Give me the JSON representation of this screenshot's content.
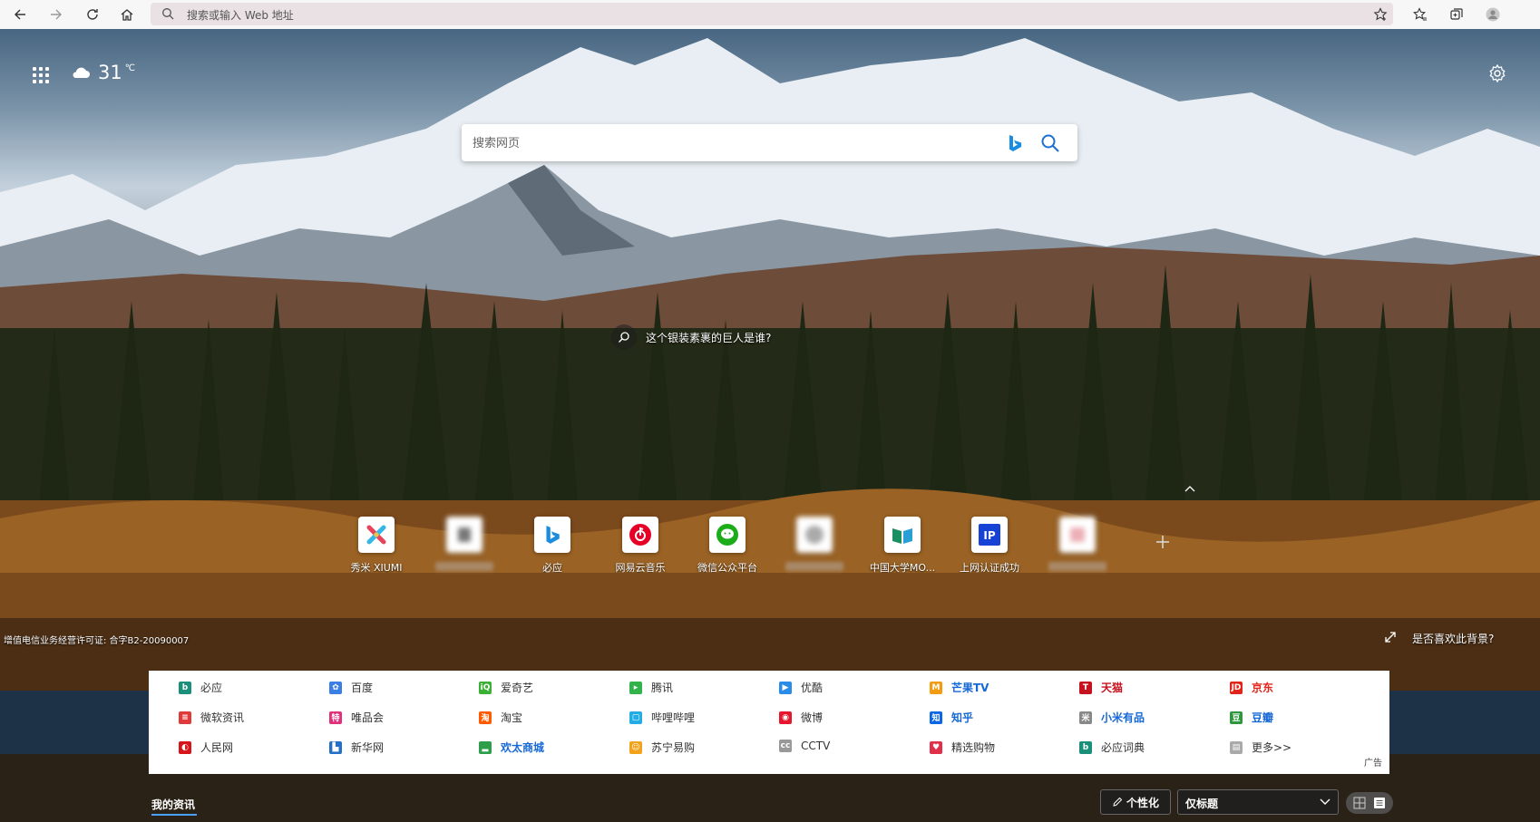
{
  "toolbar": {
    "address_placeholder": "搜索或输入 Web 地址",
    "icons": [
      "back-icon",
      "forward-icon",
      "refresh-icon",
      "home-icon",
      "search-icon",
      "add-favorite-icon",
      "favorites-icon",
      "collections-icon",
      "profile-icon"
    ]
  },
  "header": {
    "temperature": "31",
    "unit": "℃",
    "weather_icon": "cloud-icon"
  },
  "search": {
    "placeholder": "搜索网页"
  },
  "hint": {
    "text": "这个银装素裹的巨人是谁?"
  },
  "quick_links": [
    {
      "label": "秀米 XIUMI",
      "color": "#ffffff",
      "fg": "#e03c3c",
      "glyph": "✕"
    },
    {
      "label": "",
      "color": "#ffffff",
      "fg": "#666666",
      "glyph": "■"
    },
    {
      "label": "必应",
      "color": "#ffffff",
      "fg": "#1a73e8",
      "glyph": "b"
    },
    {
      "label": "网易云音乐",
      "color": "#ffffff",
      "fg": "#e60026",
      "glyph": "◎"
    },
    {
      "label": "微信公众平台",
      "color": "#ffffff",
      "fg": "#1aad19",
      "glyph": "●"
    },
    {
      "label": "",
      "color": "#ffffff",
      "fg": "#999999",
      "glyph": "■"
    },
    {
      "label": "中国大学MO...",
      "color": "#ffffff",
      "fg": "#1a8f62",
      "glyph": "▮"
    },
    {
      "label": "上网认证成功",
      "color": "#ffffff",
      "fg": "#1742d6",
      "glyph": "IP"
    },
    {
      "label": "",
      "color": "#ffffff",
      "fg": "#e79aa3",
      "glyph": "■"
    }
  ],
  "footer": {
    "license": "增值电信业务经营许可证: 合字B2-20090007",
    "like_bg": "是否喜欢此背景?"
  },
  "links": [
    [
      {
        "label": "必应",
        "icon": "b",
        "color": "#1a8f7a",
        "bold": false,
        "text_color": "#333333"
      },
      {
        "label": "百度",
        "icon": "✿",
        "color": "#3a7ee6",
        "bold": false,
        "text_color": "#333333"
      },
      {
        "label": "爱奇艺",
        "icon": "iQ",
        "color": "#3cb034",
        "bold": false,
        "text_color": "#333333"
      },
      {
        "label": "腾讯",
        "icon": "▸",
        "color": "#31b24b",
        "bold": false,
        "text_color": "#333333"
      },
      {
        "label": "优酷",
        "icon": "▶",
        "color": "#2b8be8",
        "bold": false,
        "text_color": "#333333"
      },
      {
        "label": "芒果TV",
        "icon": "M",
        "color": "#f39c12",
        "bold": true,
        "text_color": "#1668d6"
      },
      {
        "label": "天猫",
        "icon": "T",
        "color": "#c6121e",
        "bold": true,
        "text_color": "#c6121e"
      },
      {
        "label": "京东",
        "icon": "JD",
        "color": "#e1251b",
        "bold": true,
        "text_color": "#e1251b"
      }
    ],
    [
      {
        "label": "微软资讯",
        "icon": "≡",
        "color": "#e03a3a",
        "bold": false,
        "text_color": "#333333"
      },
      {
        "label": "唯品会",
        "icon": "特",
        "color": "#e0307c",
        "bold": false,
        "text_color": "#333333"
      },
      {
        "label": "淘宝",
        "icon": "淘",
        "color": "#ff5a00",
        "bold": false,
        "text_color": "#333333"
      },
      {
        "label": "哔哩哔哩",
        "icon": "▢",
        "color": "#23ade5",
        "bold": false,
        "text_color": "#333333"
      },
      {
        "label": "微博",
        "icon": "◉",
        "color": "#e6162d",
        "bold": false,
        "text_color": "#333333"
      },
      {
        "label": "知乎",
        "icon": "知",
        "color": "#0a66e4",
        "bold": true,
        "text_color": "#1668d6"
      },
      {
        "label": "小米有品",
        "icon": "米",
        "color": "#888888",
        "bold": true,
        "text_color": "#1668d6"
      },
      {
        "label": "豆瓣",
        "icon": "豆",
        "color": "#2e963d",
        "bold": true,
        "text_color": "#1668d6"
      }
    ],
    [
      {
        "label": "人民网",
        "icon": "◐",
        "color": "#d7141a",
        "bold": false,
        "text_color": "#333333"
      },
      {
        "label": "新华网",
        "icon": "▙",
        "color": "#2470c7",
        "bold": false,
        "text_color": "#333333"
      },
      {
        "label": "欢太商城",
        "icon": "▂",
        "color": "#2e9e4a",
        "bold": true,
        "text_color": "#1668d6"
      },
      {
        "label": "苏宁易购",
        "icon": "☺",
        "color": "#f3a21c",
        "bold": false,
        "text_color": "#333333"
      },
      {
        "label": "CCTV",
        "icon": "cc",
        "color": "#999999",
        "bold": false,
        "text_color": "#333333"
      },
      {
        "label": "精选购物",
        "icon": "♥",
        "color": "#e0304a",
        "bold": false,
        "text_color": "#333333"
      },
      {
        "label": "必应词典",
        "icon": "b",
        "color": "#1a8f7a",
        "bold": false,
        "text_color": "#333333"
      },
      {
        "label": "更多>>",
        "icon": "▤",
        "color": "#aaaaaa",
        "bold": false,
        "text_color": "#333333"
      }
    ]
  ],
  "ad_tag": "广告",
  "bottom_bar": {
    "my_news": "我的资讯",
    "personalize": "个性化",
    "layout_select": "仅标题"
  }
}
